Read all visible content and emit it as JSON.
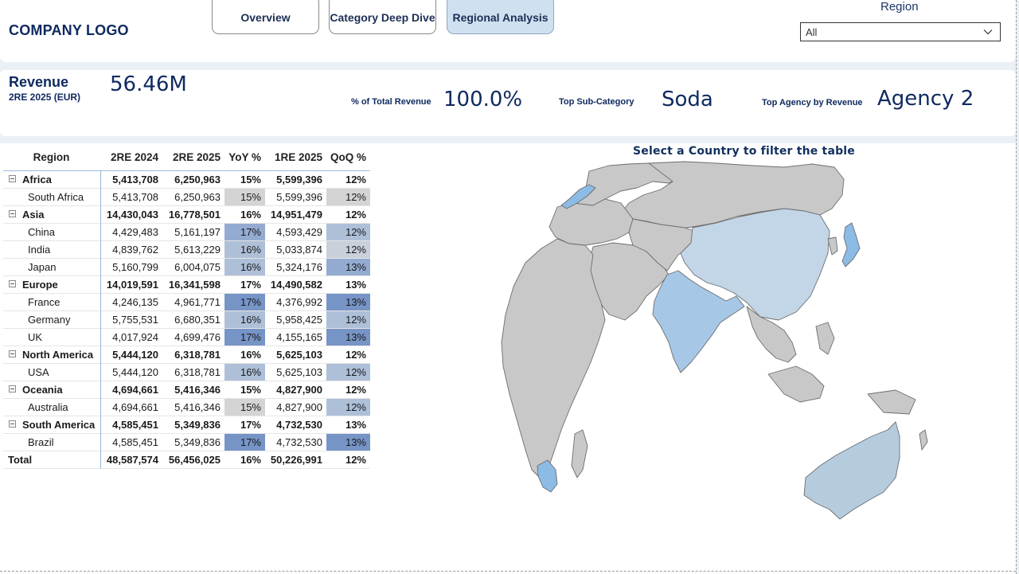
{
  "header": {
    "logo": "COMPANY LOGO",
    "tabs": [
      {
        "label": "Overview",
        "active": false
      },
      {
        "label": "Category Deep Dive",
        "active": false
      },
      {
        "label": "Regional Analysis",
        "active": true
      }
    ],
    "region_filter": {
      "label": "Region",
      "value": "All"
    }
  },
  "kpis": {
    "revenue_title": "Revenue",
    "revenue_subtitle": "2RE 2025 (EUR)",
    "revenue_value": "56.46M",
    "pct_label": "% of Total Revenue",
    "pct_value": "100.0%",
    "subcat_label": "Top Sub-Category",
    "subcat_value": "Soda",
    "agency_label": "Top Agency by Revenue",
    "agency_value": "Agency 2"
  },
  "table": {
    "headers": [
      "Region",
      "2RE 2024",
      "2RE 2025",
      "YoY %",
      "1RE 2025",
      "QoQ %"
    ],
    "rows": [
      {
        "type": "group",
        "cells": [
          "Africa",
          "5,413,708",
          "6,250,963",
          "15%",
          "5,599,396",
          "12%"
        ]
      },
      {
        "type": "child",
        "cells": [
          "South Africa",
          "5,413,708",
          "6,250,963",
          "15%",
          "5,599,396",
          "12%"
        ],
        "yoy_shade": 0,
        "qoq_shade": 0
      },
      {
        "type": "group",
        "cells": [
          "Asia",
          "14,430,043",
          "16,778,501",
          "16%",
          "14,951,479",
          "12%"
        ]
      },
      {
        "type": "child",
        "cells": [
          "China",
          "4,429,483",
          "5,161,197",
          "17%",
          "4,593,429",
          "12%"
        ],
        "yoy_shade": 3,
        "qoq_shade": 2
      },
      {
        "type": "child",
        "cells": [
          "India",
          "4,839,762",
          "5,613,229",
          "16%",
          "5,033,874",
          "12%"
        ],
        "yoy_shade": 2,
        "qoq_shade": 1
      },
      {
        "type": "child",
        "cells": [
          "Japan",
          "5,160,799",
          "6,004,075",
          "16%",
          "5,324,176",
          "13%"
        ],
        "yoy_shade": 2,
        "qoq_shade": 3
      },
      {
        "type": "group",
        "cells": [
          "Europe",
          "14,019,591",
          "16,341,598",
          "17%",
          "14,490,582",
          "13%"
        ]
      },
      {
        "type": "child",
        "cells": [
          "France",
          "4,246,135",
          "4,961,771",
          "17%",
          "4,376,992",
          "13%"
        ],
        "yoy_shade": 4,
        "qoq_shade": 4
      },
      {
        "type": "child",
        "cells": [
          "Germany",
          "5,755,531",
          "6,680,351",
          "16%",
          "5,958,425",
          "12%"
        ],
        "yoy_shade": 2,
        "qoq_shade": 2
      },
      {
        "type": "child",
        "cells": [
          "UK",
          "4,017,924",
          "4,699,476",
          "17%",
          "4,155,165",
          "13%"
        ],
        "yoy_shade": 4,
        "qoq_shade": 4
      },
      {
        "type": "group",
        "cells": [
          "North America",
          "5,444,120",
          "6,318,781",
          "16%",
          "5,625,103",
          "12%"
        ]
      },
      {
        "type": "child",
        "cells": [
          "USA",
          "5,444,120",
          "6,318,781",
          "16%",
          "5,625,103",
          "12%"
        ],
        "yoy_shade": 2,
        "qoq_shade": 2
      },
      {
        "type": "group",
        "cells": [
          "Oceania",
          "4,694,661",
          "5,416,346",
          "15%",
          "4,827,900",
          "12%"
        ]
      },
      {
        "type": "child",
        "cells": [
          "Australia",
          "4,694,661",
          "5,416,346",
          "15%",
          "4,827,900",
          "12%"
        ],
        "yoy_shade": 0,
        "qoq_shade": 2
      },
      {
        "type": "group",
        "cells": [
          "South America",
          "4,585,451",
          "5,349,836",
          "17%",
          "4,732,530",
          "13%"
        ]
      },
      {
        "type": "child",
        "cells": [
          "Brazil",
          "4,585,451",
          "5,349,836",
          "17%",
          "4,732,530",
          "13%"
        ],
        "yoy_shade": 4,
        "qoq_shade": 4
      },
      {
        "type": "total",
        "cells": [
          "Total",
          "48,587,574",
          "56,456,025",
          "16%",
          "50,226,991",
          "12%"
        ]
      }
    ],
    "shade_colors": [
      "#d4d4d4",
      "#c9d0da",
      "#aebfd8",
      "#94abd1",
      "#7794c7"
    ]
  },
  "map": {
    "title": "Select a Country to filter the table",
    "colors": {
      "land": "#c8c8c8",
      "border": "#6d6d6d",
      "highlight_light": "#c2d6e8",
      "highlight_mid": "#a6c8e6",
      "highlight_strong": "#8cbbe6"
    }
  }
}
